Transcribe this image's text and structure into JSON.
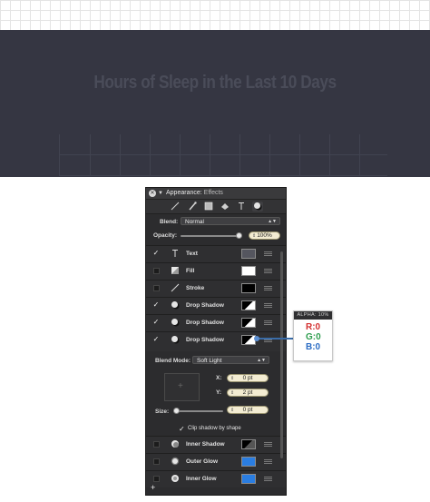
{
  "canvas": {
    "title": "Hours of Sleep in the Last 10 Days",
    "background": "#353642"
  },
  "panel": {
    "title": "Appearance:",
    "subtitle": "Effects",
    "toolbar_icons": [
      "line-icon",
      "brush-icon",
      "square-icon",
      "eraser-icon",
      "text-icon",
      "shadow-icon"
    ],
    "blend_label": "Blend:",
    "blend_value": "Normal",
    "opacity_label": "Opacity:",
    "opacity_value": "100%",
    "effects": [
      {
        "label": "Text",
        "checked": true,
        "icon": "text-icon",
        "swatch": "#55565f"
      },
      {
        "label": "Fill",
        "checked": false,
        "icon": "fill-icon",
        "swatch": "#ffffff"
      },
      {
        "label": "Stroke",
        "checked": false,
        "icon": "stroke-icon",
        "swatch": "#000000"
      },
      {
        "label": "Drop Shadow",
        "checked": true,
        "icon": "shadow-icon",
        "swatch": "split"
      },
      {
        "label": "Drop Shadow",
        "checked": true,
        "icon": "shadow-icon",
        "swatch": "split"
      },
      {
        "label": "Drop Shadow",
        "checked": true,
        "icon": "shadow-icon",
        "swatch": "split"
      }
    ],
    "blend_mode_label": "Blend Mode:",
    "blend_mode_value": "Soft Light",
    "x_label": "X:",
    "x_value": "0 pt",
    "y_label": "Y:",
    "y_value": "2 pt",
    "size_label": "Size:",
    "size_value": "0 pt",
    "clip_label": "Clip shadow by shape",
    "lower_effects": [
      {
        "label": "Inner Shadow",
        "checked": false,
        "swatch": "split"
      },
      {
        "label": "Outer Glow",
        "checked": false,
        "swatch": "#2a7de1"
      },
      {
        "label": "Inner Glow",
        "checked": false,
        "swatch": "#2a7de1"
      }
    ],
    "add_label": "+"
  },
  "color_callout": {
    "header": "ALPHA: 10%",
    "r": "R:0",
    "g": "G:0",
    "b": "B:0",
    "r_color": "#d32f2f",
    "g_color": "#2e9e4f",
    "b_color": "#2b6cc4"
  }
}
